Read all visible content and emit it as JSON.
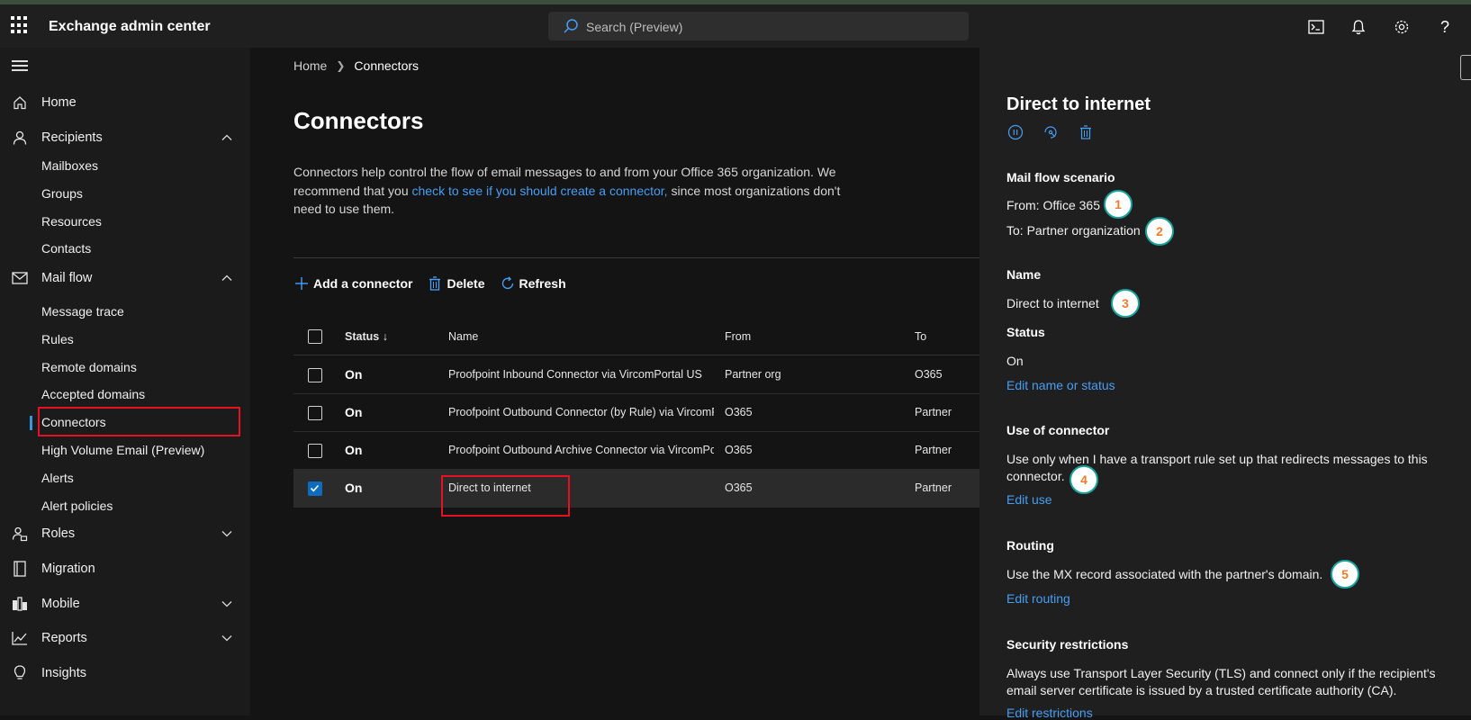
{
  "header": {
    "app_title": "Exchange admin center",
    "search_placeholder": "Search (Preview)",
    "icons": [
      "app-launcher-icon",
      "search-icon",
      "terminal-icon",
      "bell-icon",
      "gear-icon",
      "help-icon"
    ]
  },
  "sidebar": {
    "home": "Home",
    "recipients": "Recipients",
    "recipients_items": [
      "Mailboxes",
      "Groups",
      "Resources",
      "Contacts"
    ],
    "mail_flow": "Mail flow",
    "mail_flow_items": [
      "Message trace",
      "Rules",
      "Remote domains",
      "Accepted domains",
      "Connectors",
      "High Volume Email (Preview)",
      "Alerts",
      "Alert policies"
    ],
    "roles": "Roles",
    "migration": "Migration",
    "mobile": "Mobile",
    "reports": "Reports",
    "insights": "Insights",
    "active_item": "Connectors"
  },
  "main": {
    "breadcrumb": {
      "home": "Home",
      "current": "Connectors"
    },
    "title": "Connectors",
    "desc_part1": "Connectors help control the flow of email messages to and from your Office 365 organization. We recommend that you ",
    "desc_link": "check to see if you should create a connector,",
    "desc_part2": " since most organizations don't need to use them.",
    "toolbar": {
      "add": "Add a connector",
      "delete": "Delete",
      "refresh": "Refresh"
    },
    "columns": {
      "status": "Status",
      "name": "Name",
      "from": "From",
      "to": "To"
    },
    "rows": [
      {
        "status": "On",
        "name": "Proofpoint Inbound Connector via VircomPortal US",
        "from": "Partner org",
        "to": "O365",
        "selected": false
      },
      {
        "status": "On",
        "name": "Proofpoint Outbound Connector (by Rule) via VircomP...",
        "from": "O365",
        "to": "Partner",
        "selected": false
      },
      {
        "status": "On",
        "name": "Proofpoint Outbound Archive Connector via VircomPo...",
        "from": "O365",
        "to": "Partner",
        "selected": false
      },
      {
        "status": "On",
        "name": "Direct to internet",
        "from": "O365",
        "to": "Partner",
        "selected": true
      }
    ]
  },
  "panel": {
    "title": "Direct to internet",
    "action_icons": [
      "pause-icon",
      "test-connector-icon",
      "delete-icon"
    ],
    "mail_flow_heading": "Mail flow scenario",
    "from_line": "From: Office 365",
    "to_line": "To: Partner organization",
    "name_heading": "Name",
    "name_value": "Direct to internet",
    "status_heading": "Status",
    "status_value": "On",
    "edit_name_link": "Edit name or status",
    "use_heading": "Use of connector",
    "use_text": "Use only when I have a transport rule set up that redirects messages to this connector.",
    "edit_use_link": "Edit use",
    "routing_heading": "Routing",
    "routing_text": "Use the MX record associated with the partner's domain.",
    "edit_routing_link": "Edit routing",
    "security_heading": "Security restrictions",
    "security_text": "Always use Transport Layer Security (TLS) and connect only if the recipient's email server certificate is issued by a trusted certificate authority (CA).",
    "edit_restrictions_link": "Edit restrictions"
  },
  "callouts": [
    "1",
    "2",
    "3",
    "4",
    "5"
  ],
  "colors": {
    "accent": "#479ef5",
    "highlight": "#e81123",
    "callout_border": "#1aa39c",
    "callout_text": "#f07c2e"
  }
}
